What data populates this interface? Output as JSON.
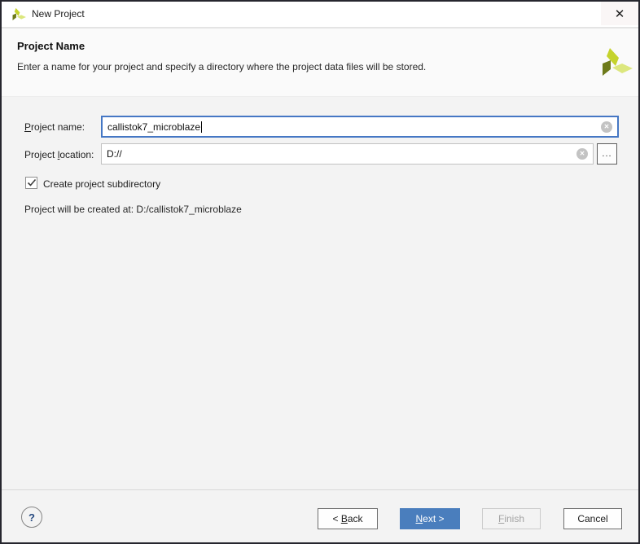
{
  "window": {
    "title": "New Project"
  },
  "icons": {
    "close": "✕",
    "clear": "✕"
  },
  "header": {
    "title": "Project Name",
    "description": "Enter a name for your project and specify a directory where the project data files will be stored."
  },
  "form": {
    "name_label": {
      "pre": "",
      "mn": "P",
      "rest": "roject name:"
    },
    "name_value": "callistok7_microblaze",
    "location_label": {
      "pre": "Project ",
      "mn": "l",
      "rest": "ocation:"
    },
    "location_value": "D://",
    "browse_label": "...",
    "subdir_label": "Create project subdirectory",
    "created_at": "Project will be created at: D:/callistok7_microblaze"
  },
  "footer": {
    "help": "?",
    "back": {
      "pre": "< ",
      "mn": "B",
      "rest": "ack"
    },
    "next": {
      "pre": "",
      "mn": "N",
      "rest": "ext >"
    },
    "finish": {
      "pre": "",
      "mn": "F",
      "rest": "inish"
    },
    "cancel": "Cancel"
  },
  "colors": {
    "accent_button": "#4a7ebd",
    "focus_border": "#4577c4",
    "logo_bright": "#c5d32c",
    "logo_dark": "#6d7a1a",
    "logo_pale": "#dce77e"
  }
}
